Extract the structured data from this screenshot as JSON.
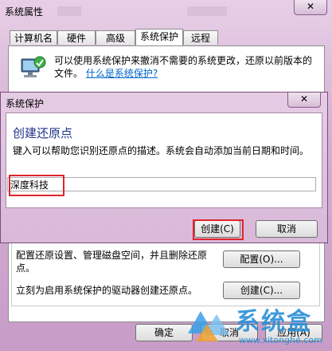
{
  "outer_window": {
    "title": "系统属性",
    "close_glyph": "✕",
    "tabs": [
      "计算机名",
      "硬件",
      "高级",
      "系统保护",
      "远程"
    ],
    "active_tab": "系统保护",
    "description": "可以使用系统保护来撤消不需要的系统更改，还原以前版本的文件。",
    "link": "什么是系统保护?",
    "configure_text": "配置还原设置、管理磁盘空间，并且删除还原点。",
    "configure_button": "配置(O)...",
    "create_text": "立刻为启用系统保护的驱动器创建还原点。",
    "create_button": "创建(C)...",
    "ok_button": "确定",
    "cancel_button": "取消",
    "apply_button": "应用(A)"
  },
  "dialog": {
    "title": "系统保护",
    "close_glyph": "✕",
    "heading": "创建还原点",
    "description": "键入可以帮助您识别还原点的描述。系统会自动添加当前日期和时间。",
    "input_value": "深度科技",
    "create_button": "创建(C)",
    "cancel_button": "取消"
  },
  "watermark": {
    "brand": "系统盒",
    "url": "www.xitonghe.com"
  },
  "icons": {
    "computer": "computer-restore-icon",
    "watermark_logo": "xitonghe-logo-icon"
  },
  "colors": {
    "highlight": "#e0242b",
    "heading": "#1e3287",
    "link": "#0066cc"
  }
}
